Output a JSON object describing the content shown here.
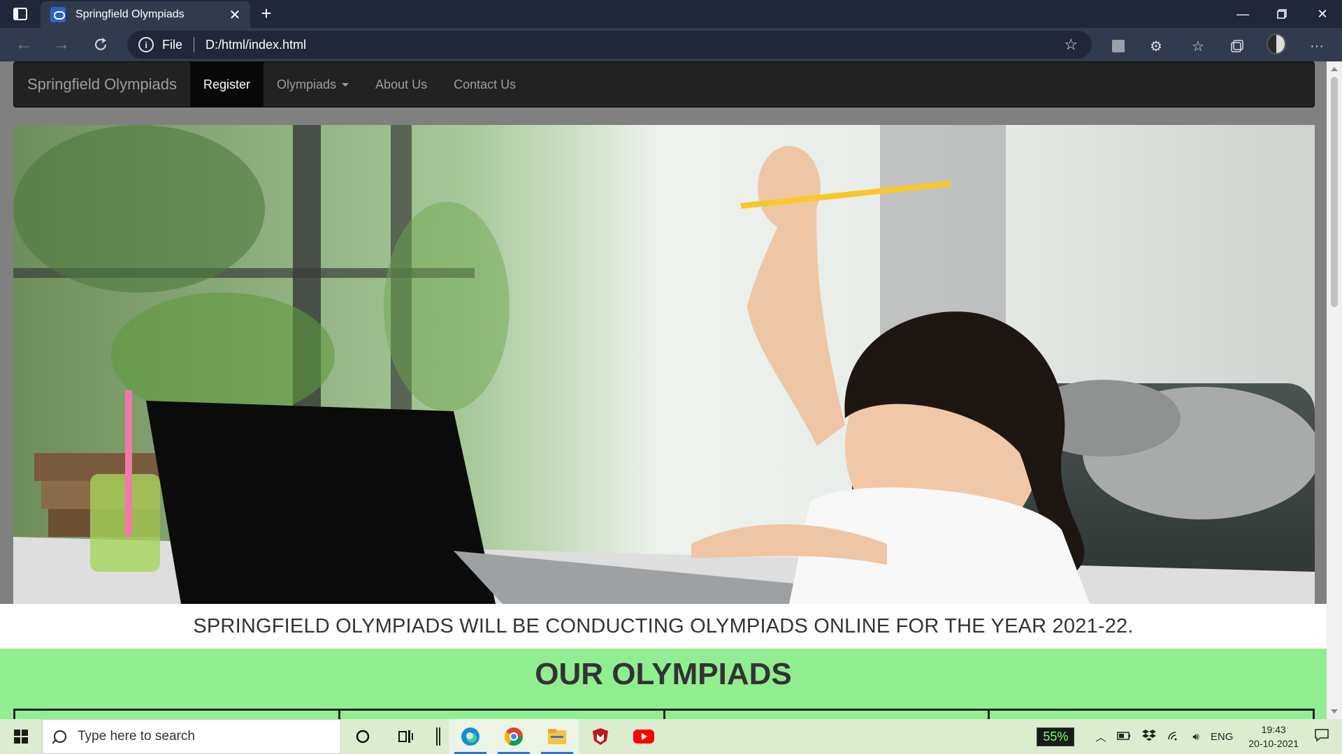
{
  "browser": {
    "tab_title": "Springfield Olympiads",
    "url_scheme_label": "File",
    "url": "D:/html/index.html"
  },
  "site": {
    "brand": "Springfield Olympiads",
    "nav": [
      {
        "label": "Register",
        "active": true
      },
      {
        "label": "Olympiads",
        "dropdown": true
      },
      {
        "label": "About Us"
      },
      {
        "label": "Contact Us"
      }
    ],
    "announcement": "SPRINGFIELD OLYMPIADS WILL BE CONDUCTING OLYMPIADS ONLINE FOR THE YEAR 2021-22.",
    "section_title": "OUR OLYMPIADS"
  },
  "taskbar": {
    "search_placeholder": "Type here to search",
    "battery": "55%",
    "language": "ENG",
    "time": "19:43",
    "date": "20-10-2021"
  },
  "colors": {
    "navbar_bg": "#222222",
    "olympiad_band": "#90ee90",
    "titlebar": "#1f2738",
    "toolbar": "#323b4e"
  }
}
